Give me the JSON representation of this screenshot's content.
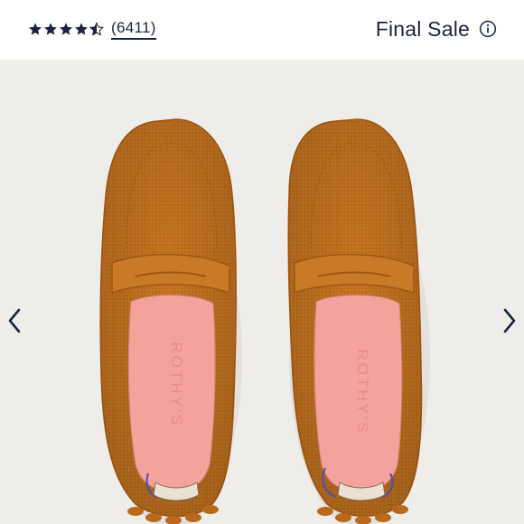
{
  "rating": {
    "value": 4.5,
    "max": 5,
    "count_text": "(6411)",
    "star_color": "#1c2340"
  },
  "badge": {
    "label": "Final Sale",
    "icon": "info-icon"
  },
  "gallery": {
    "background": "#efedea",
    "image": {
      "subject": "pair of orange knit driving loafers",
      "insole_text": "ROTHY'S",
      "upper_color": "#c4731f",
      "insole_color": "#f3a39b"
    },
    "prev_icon": "chevron-left-icon",
    "next_icon": "chevron-right-icon"
  }
}
